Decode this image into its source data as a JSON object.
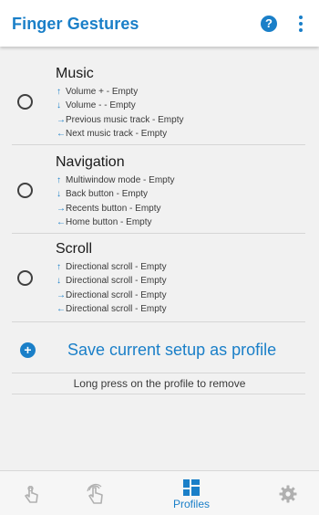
{
  "header": {
    "title": "Finger Gestures",
    "help_icon": "?",
    "more_icon": "more-vertical-icon"
  },
  "profiles": [
    {
      "name": "Music",
      "gestures": [
        {
          "icon": "↑",
          "label": "Volume + - Empty"
        },
        {
          "icon": "↓",
          "label": "Volume - - Empty"
        },
        {
          "icon": "→",
          "label": "Previous music track - Empty"
        },
        {
          "icon": "←",
          "label": "Next music track - Empty"
        }
      ]
    },
    {
      "name": "Navigation",
      "gestures": [
        {
          "icon": "↑",
          "label": "Multiwindow mode - Empty"
        },
        {
          "icon": "↓",
          "label": "Back button - Empty"
        },
        {
          "icon": "→",
          "label": "Recents button - Empty"
        },
        {
          "icon": "←",
          "label": "Home button - Empty"
        }
      ]
    },
    {
      "name": "Scroll",
      "gestures": [
        {
          "icon": "↑",
          "label": "Directional scroll - Empty"
        },
        {
          "icon": "↓",
          "label": "Directional scroll - Empty"
        },
        {
          "icon": "→",
          "label": "Directional scroll - Empty"
        },
        {
          "icon": "←",
          "label": "Directional scroll - Empty"
        }
      ]
    }
  ],
  "save": {
    "icon": "+",
    "label": "Save current setup as profile"
  },
  "hint": "Long press on the profile to remove",
  "bottom_nav": {
    "items": [
      {
        "icon": "single-finger-tap-icon",
        "label": ""
      },
      {
        "icon": "multi-finger-tap-icon",
        "label": ""
      },
      {
        "icon": "profiles-grid-icon",
        "label": "Profiles",
        "active": true
      },
      {
        "icon": "gear-icon",
        "label": ""
      }
    ]
  },
  "colors": {
    "accent": "#1a7fc8",
    "background": "#f1f1f1",
    "inactive_icon": "#b0b0b0"
  }
}
